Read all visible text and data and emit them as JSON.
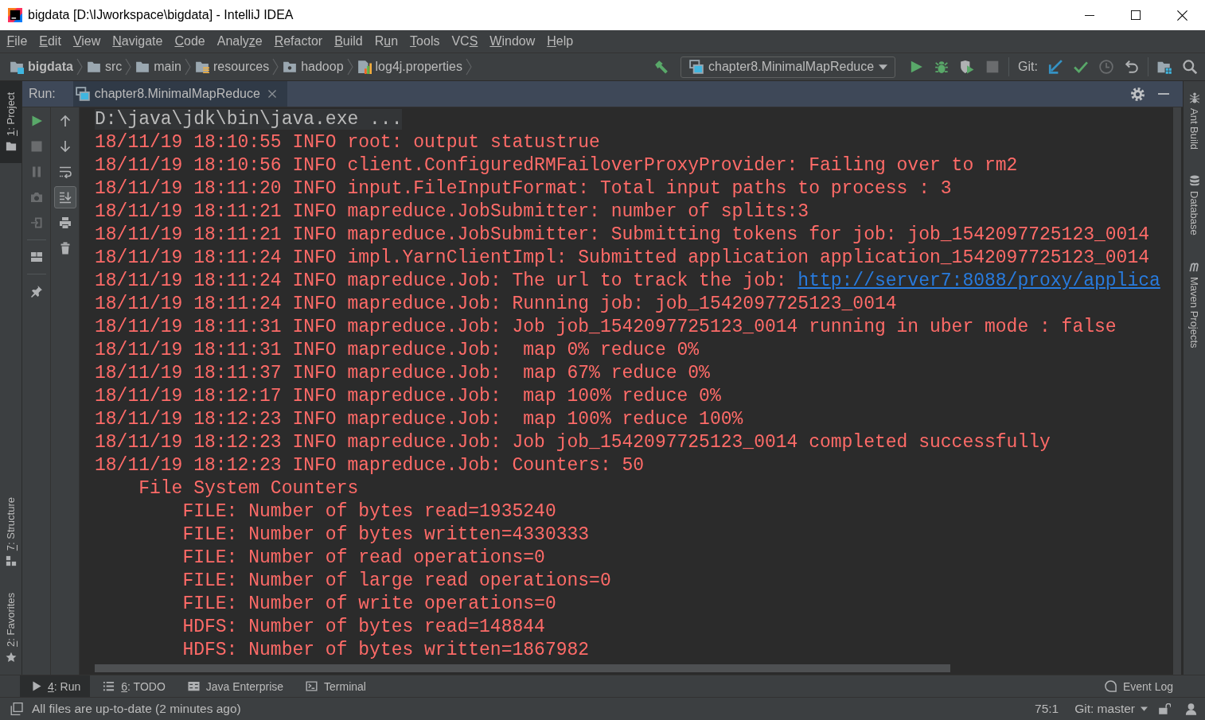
{
  "window": {
    "title": "bigdata [D:\\IJworkspace\\bigdata] - IntelliJ IDEA"
  },
  "menu": [
    {
      "key": "F",
      "post": "ile"
    },
    {
      "key": "E",
      "post": "dit"
    },
    {
      "key": "V",
      "post": "iew"
    },
    {
      "key": "N",
      "post": "avigate"
    },
    {
      "key": "C",
      "post": "ode"
    },
    {
      "pre": "Analy",
      "key": "z",
      "post": "e"
    },
    {
      "key": "R",
      "post": "efactor"
    },
    {
      "key": "B",
      "post": "uild"
    },
    {
      "pre": "R",
      "key": "u",
      "post": "n"
    },
    {
      "key": "T",
      "post": "ools"
    },
    {
      "pre": "VC",
      "key": "S"
    },
    {
      "key": "W",
      "post": "indow"
    },
    {
      "key": "H",
      "post": "elp"
    }
  ],
  "navigation_bar": [
    {
      "kind": "module",
      "label": "bigdata"
    },
    {
      "kind": "folder",
      "label": "src"
    },
    {
      "kind": "folder",
      "label": "main"
    },
    {
      "kind": "resources",
      "label": "resources"
    },
    {
      "kind": "package",
      "label": "hadoop"
    },
    {
      "kind": "properties",
      "label": "log4j.properties"
    }
  ],
  "toolbar": [
    {
      "items": [
        {
          "kind": "build",
          "disabled": false
        },
        {
          "kind": "run_config",
          "label": "chapter8.MinimalMapReduce",
          "disabled": false
        },
        {
          "kind": "run",
          "disabled": false
        },
        {
          "kind": "debug",
          "disabled": false
        },
        {
          "kind": "coverage",
          "disabled": false
        },
        {
          "kind": "stop",
          "disabled": true
        }
      ]
    },
    {
      "label": "Git:",
      "items": [
        {
          "kind": "update",
          "disabled": false
        },
        {
          "kind": "commit",
          "disabled": false
        },
        {
          "kind": "history",
          "disabled": true
        },
        {
          "kind": "revert",
          "disabled": false
        }
      ]
    },
    {
      "items": [
        {
          "kind": "project_structure",
          "disabled": false
        },
        {
          "kind": "search",
          "disabled": false
        }
      ]
    }
  ],
  "left_stripe": {
    "top": [
      {
        "kind": "project",
        "key": "1",
        "post": ": Project",
        "selected": true
      }
    ],
    "bottom": [
      {
        "kind": "structure",
        "key": "7",
        "post": ": Structure",
        "selected": false
      },
      {
        "kind": "favorites",
        "key": "2",
        "post": ": Favorites",
        "selected": false
      }
    ]
  },
  "run_panel": {
    "title": "Run:",
    "tabs": [
      {
        "label": "chapter8.MinimalMapReduce",
        "selected": true
      }
    ],
    "actions": [
      {
        "kind": "settings"
      },
      {
        "kind": "hide"
      }
    ],
    "execution_toolbar": [
      [
        {
          "kind": "rerun",
          "disabled": false
        },
        {
          "kind": "stop",
          "disabled": true
        },
        {
          "kind": "pause",
          "disabled": true
        },
        {
          "kind": "dump_threads",
          "disabled": true
        },
        {
          "kind": "exit",
          "disabled": true
        }
      ],
      [
        {
          "kind": "layout",
          "disabled": false
        }
      ],
      [
        {
          "kind": "pin",
          "disabled": false
        }
      ]
    ],
    "console_toolbar": [
      {
        "kind": "up",
        "on": false
      },
      {
        "kind": "down",
        "on": false
      },
      {
        "kind": "soft_wrap",
        "on": false
      },
      {
        "kind": "scroll_to_end",
        "on": true
      },
      {
        "kind": "print",
        "on": false
      },
      {
        "kind": "clear",
        "on": false
      }
    ],
    "console": [
      {
        "kind": "command",
        "text": "D:\\java\\jdk\\bin\\java.exe",
        "fold": "..."
      },
      {
        "kind": "stderr",
        "text": "18/11/19 18:10:55 INFO root: output statustrue"
      },
      {
        "kind": "stderr",
        "text": "18/11/19 18:10:56 INFO client.ConfiguredRMFailoverProxyProvider: Failing over to rm2"
      },
      {
        "kind": "stderr",
        "text": "18/11/19 18:11:20 INFO input.FileInputFormat: Total input paths to process : 3"
      },
      {
        "kind": "stderr",
        "text": "18/11/19 18:11:21 INFO mapreduce.JobSubmitter: number of splits:3"
      },
      {
        "kind": "stderr",
        "text": "18/11/19 18:11:21 INFO mapreduce.JobSubmitter: Submitting tokens for job: job_1542097725123_0014"
      },
      {
        "kind": "stderr",
        "text": "18/11/19 18:11:24 INFO impl.YarnClientImpl: Submitted application application_1542097725123_0014"
      },
      {
        "kind": "stderr",
        "text": "18/11/19 18:11:24 INFO mapreduce.Job: The url to track the job: ",
        "link": "http://server7:8088/proxy/applica"
      },
      {
        "kind": "stderr",
        "text": "18/11/19 18:11:24 INFO mapreduce.Job: Running job: job_1542097725123_0014"
      },
      {
        "kind": "stderr",
        "text": "18/11/19 18:11:31 INFO mapreduce.Job: Job job_1542097725123_0014 running in uber mode : false"
      },
      {
        "kind": "stderr",
        "text": "18/11/19 18:11:31 INFO mapreduce.Job:  map 0% reduce 0%"
      },
      {
        "kind": "stderr",
        "text": "18/11/19 18:11:37 INFO mapreduce.Job:  map 67% reduce 0%"
      },
      {
        "kind": "stderr",
        "text": "18/11/19 18:12:17 INFO mapreduce.Job:  map 100% reduce 0%"
      },
      {
        "kind": "stderr",
        "text": "18/11/19 18:12:23 INFO mapreduce.Job:  map 100% reduce 100%"
      },
      {
        "kind": "stderr",
        "text": "18/11/19 18:12:23 INFO mapreduce.Job: Job job_1542097725123_0014 completed successfully"
      },
      {
        "kind": "stderr",
        "text": "18/11/19 18:12:23 INFO mapreduce.Job: Counters: 50",
        "children": [
          {
            "kind": "stderr",
            "text": "File System Counters",
            "children": [
              {
                "kind": "stderr",
                "text": "FILE: Number of bytes read=1935240"
              },
              {
                "kind": "stderr",
                "text": "FILE: Number of bytes written=4330333"
              },
              {
                "kind": "stderr",
                "text": "FILE: Number of read operations=0"
              },
              {
                "kind": "stderr",
                "text": "FILE: Number of large read operations=0"
              },
              {
                "kind": "stderr",
                "text": "FILE: Number of write operations=0"
              },
              {
                "kind": "stderr",
                "text": "HDFS: Number of bytes read=148844"
              },
              {
                "kind": "stderr",
                "text": "HDFS: Number of bytes written=1867982"
              }
            ]
          }
        ]
      }
    ]
  },
  "right_stripe": [
    {
      "kind": "ant",
      "label": "Ant Build",
      "selected": false
    },
    {
      "kind": "database",
      "label": "Database",
      "selected": false
    },
    {
      "kind": "maven",
      "label": "Maven Projects",
      "selected": false
    }
  ],
  "bottom_tool_tabs": [
    {
      "kind": "run",
      "key": "4",
      "post": ": Run",
      "selected": true
    },
    {
      "kind": "todo",
      "key": "6",
      "post": ": TODO",
      "selected": false
    },
    {
      "kind": "java_enterprise",
      "label": "Java Enterprise",
      "selected": false
    },
    {
      "kind": "terminal",
      "label": "Terminal",
      "selected": false
    }
  ],
  "bottom_tool_tabs_right": [
    {
      "kind": "event_log",
      "label": "Event Log",
      "selected": false
    }
  ],
  "status_bar": {
    "message": "All files are up-to-date (2 minutes ago)",
    "position": "75:1",
    "vcs_branch": "Git: master"
  }
}
